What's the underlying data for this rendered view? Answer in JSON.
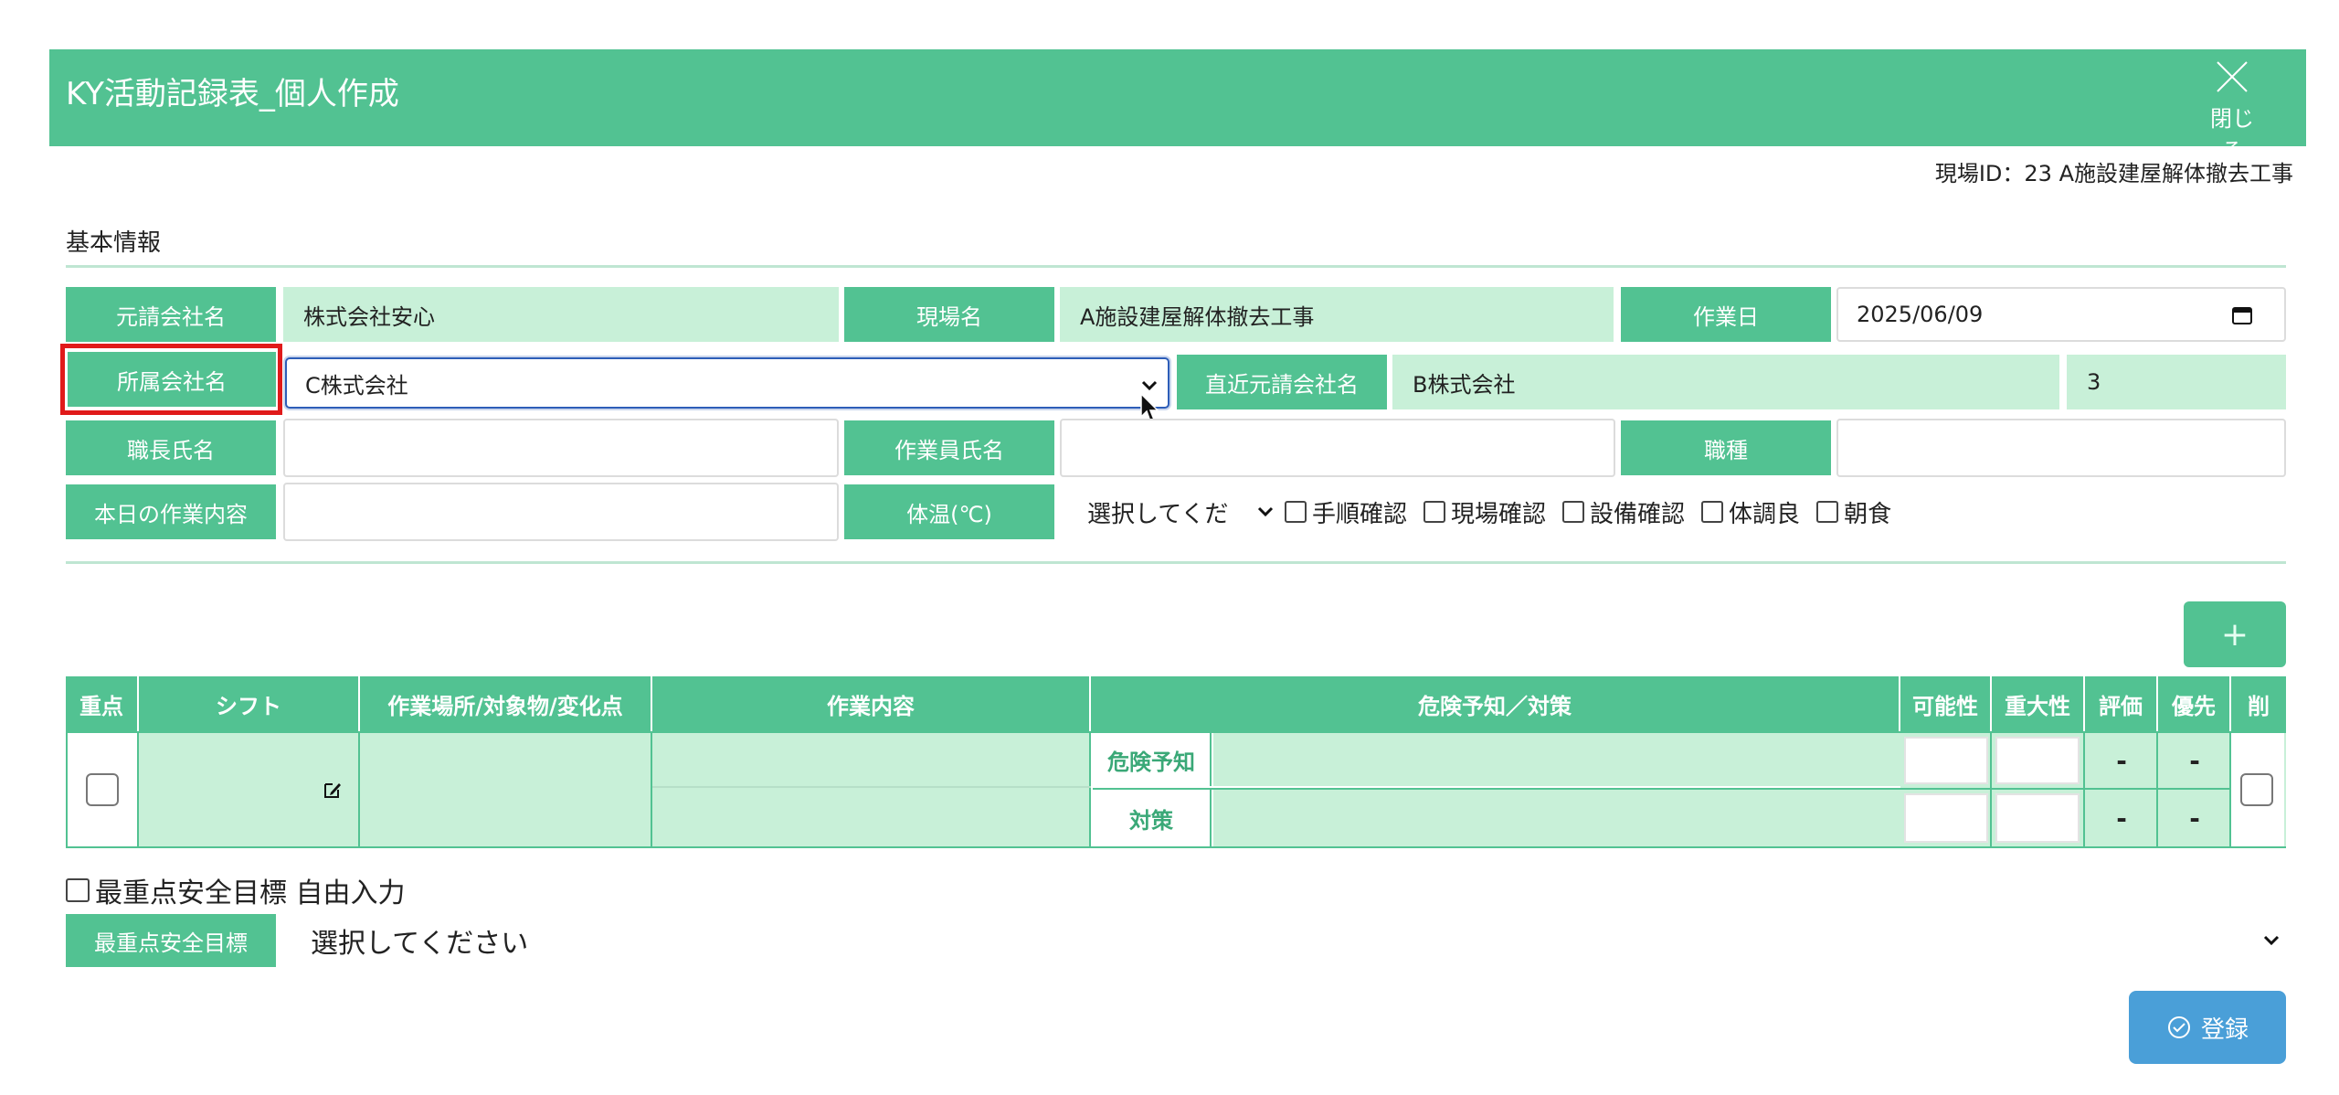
{
  "app": {
    "title": "KY活動記録表_個人作成",
    "close_label": "閉じる"
  },
  "site_id_text": "現場ID：23 A施設建屋解体撤去工事",
  "section_basic": "基本情報",
  "basic": {
    "prime_contractor_label": "元請会社名",
    "prime_contractor_value": "株式会社安心",
    "site_name_label": "現場名",
    "site_name_value": "A施設建屋解体撤去工事",
    "work_date_label": "作業日",
    "work_date_value": "2025/06/09",
    "company_label": "所属会社名",
    "company_value": "C株式会社",
    "direct_contractor_label": "直近元請会社名",
    "direct_contractor_value": "B株式会社",
    "direct_contractor_extra": "3",
    "foreman_label": "職長氏名",
    "foreman_value": "",
    "worker_label": "作業員氏名",
    "worker_value": "",
    "job_type_label": "職種",
    "job_type_value": "",
    "todays_work_label": "本日の作業内容",
    "todays_work_value": "",
    "temp_label": "体温(℃)",
    "temp_value": "選択してくだ",
    "checks": [
      "手順確認",
      "現場確認",
      "設備確認",
      "体調良",
      "朝食"
    ]
  },
  "add_button_label": "+",
  "table": {
    "headers": [
      "重点",
      "シフト",
      "作業場所/対象物/変化点",
      "作業内容",
      "危険予知／対策",
      "可能性",
      "重大性",
      "評価",
      "優先",
      "削"
    ],
    "row_labels": {
      "hazard": "危険予知",
      "measure": "対策"
    },
    "eval_values": [
      "-",
      "-"
    ],
    "priority_values": [
      "-",
      "-"
    ]
  },
  "free_input_label": "最重点安全目標 自由入力",
  "safety_goal": {
    "label": "最重点安全目標",
    "value": "選択してください"
  },
  "register_label": "登録",
  "colors": {
    "header": "#52c292",
    "readonly": "#c8f0d8",
    "highlight": "#e01a1a",
    "register": "#4a9fd8"
  }
}
